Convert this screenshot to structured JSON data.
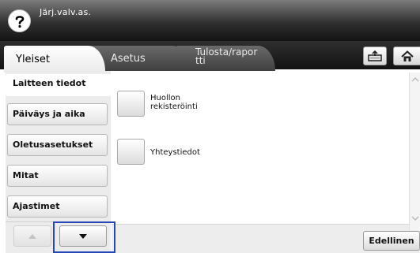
{
  "header": {
    "title": "Järj.valv.as.",
    "help_icon": "question-mark-icon"
  },
  "tabs": [
    {
      "label": "Yleiset",
      "active": true
    },
    {
      "label": "Asetus",
      "active": false
    },
    {
      "label": "Tulosta/rapor\ntti",
      "active": false
    }
  ],
  "toolbar": {
    "upload_icon": "tray-export-icon",
    "home_icon": "home-icon"
  },
  "sidebar": {
    "items": [
      {
        "label": "Laitteen tiedot",
        "active": true
      },
      {
        "label": "Päiväys ja aika",
        "active": false
      },
      {
        "label": "Oletusasetukset",
        "active": false
      },
      {
        "label": "Mitat",
        "active": false
      },
      {
        "label": "Ajastimet",
        "active": false
      }
    ]
  },
  "options": [
    {
      "label": "Huollon\nrekisteröinti"
    },
    {
      "label": "Yhteystiedot"
    }
  ],
  "footer": {
    "back_label": "Edellinen"
  },
  "colors": {
    "highlight_border": "#2547b8",
    "title_bar": "#1a1a1a"
  }
}
